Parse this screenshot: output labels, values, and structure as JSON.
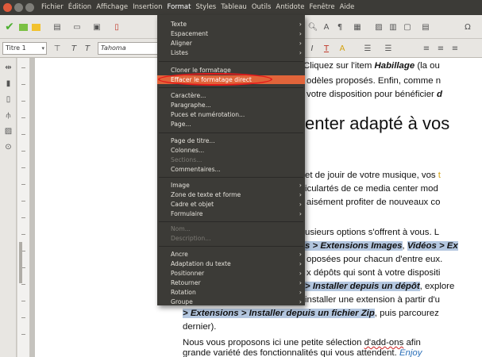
{
  "menubar": {
    "items": [
      "Fichier",
      "Édition",
      "Affichage",
      "Insertion",
      "Format",
      "Styles",
      "Tableau",
      "Outils",
      "Antidote",
      "Fenêtre",
      "Aide"
    ],
    "active": "Format",
    "window_buttons": {
      "close": "#e05a3b",
      "minimize": "#7f7e79",
      "maximize": "#7f7e79"
    }
  },
  "toolbar2": {
    "paragraph_style": "Titre 1",
    "font_name": "Tahoma"
  },
  "format_menu": {
    "accent_color": "#e1643a",
    "items": [
      {
        "label": "Texte",
        "submenu": true
      },
      {
        "label": "Espacement",
        "submenu": true
      },
      {
        "label": "Aligner",
        "submenu": true
      },
      {
        "label": "Listes",
        "submenu": true
      },
      {
        "label": "Cloner le formatage",
        "submenu": false
      },
      {
        "label": "Effacer le formatage direct",
        "submenu": false,
        "highlighted": true
      },
      {
        "label": "Caractère...",
        "submenu": false
      },
      {
        "label": "Paragraphe...",
        "submenu": false
      },
      {
        "label": "Puces et numérotation...",
        "submenu": false
      },
      {
        "label": "Page...",
        "submenu": false
      },
      {
        "label": "Page de titre...",
        "submenu": false
      },
      {
        "label": "Colonnes...",
        "submenu": false
      },
      {
        "label": "Sections...",
        "submenu": false,
        "disabled": true
      },
      {
        "label": "Commentaires...",
        "submenu": false
      },
      {
        "label": "Image",
        "submenu": true
      },
      {
        "label": "Zone de texte et forme",
        "submenu": true
      },
      {
        "label": "Cadre et objet",
        "submenu": true
      },
      {
        "label": "Formulaire",
        "submenu": true
      },
      {
        "label": "Nom...",
        "submenu": false,
        "disabled": true
      },
      {
        "label": "Description...",
        "submenu": false,
        "disabled": true
      },
      {
        "label": "Ancre",
        "submenu": true
      },
      {
        "label": "Adaptation du texte",
        "submenu": true
      },
      {
        "label": "Positionner",
        "submenu": true
      },
      {
        "label": "Retourner",
        "submenu": true
      },
      {
        "label": "Rotation",
        "submenu": true
      },
      {
        "label": "Groupe",
        "submenu": true
      }
    ]
  },
  "document": {
    "l1a": "Cliquez sur l'item ",
    "l1b": "Habillage",
    "l1c": " (la ou",
    "l2": "odèles proposés. Enfin, comme n",
    "l3a": "votre disposition pour bénéficier ",
    "l3b": "d",
    "heading": "enter adapté à vos",
    "p2l1a": "et de jouir de votre musique, vos ",
    "p2l1b": "t",
    "p2l2": "iculartés de ce media center mod",
    "p2l3": "aisément profiter de nouveaux co",
    "p3l1": "usieurs options s'offrent à vous. L",
    "p3l2a": "s > Extensions Images",
    "p3l2b": ", ",
    "p3l2c": "Vidéos > Ex",
    "p3l3": "oposées pour chacun d'entre eux.",
    "p3l4": "x dépôts qui sont à votre dispositi",
    "p3l5a": "> Installer depuis un dépôt",
    "p3l5b": ", explore",
    "p3l6": "installer une extension à partir d'u",
    "p3l7a": "> Extensions > Installer depuis un fichier Zip",
    "p3l7b": ", puis parcourez",
    "p3l8": "dernier).",
    "p4l1a": "Nous vous proposons ici une petite sélection ",
    "p4l1b": "d'add-ons",
    "p4l1c": " afin",
    "p4l2a": "grande variété des fonctionnalités qui vous attendent. ",
    "p4l2b": "Enjoy"
  }
}
